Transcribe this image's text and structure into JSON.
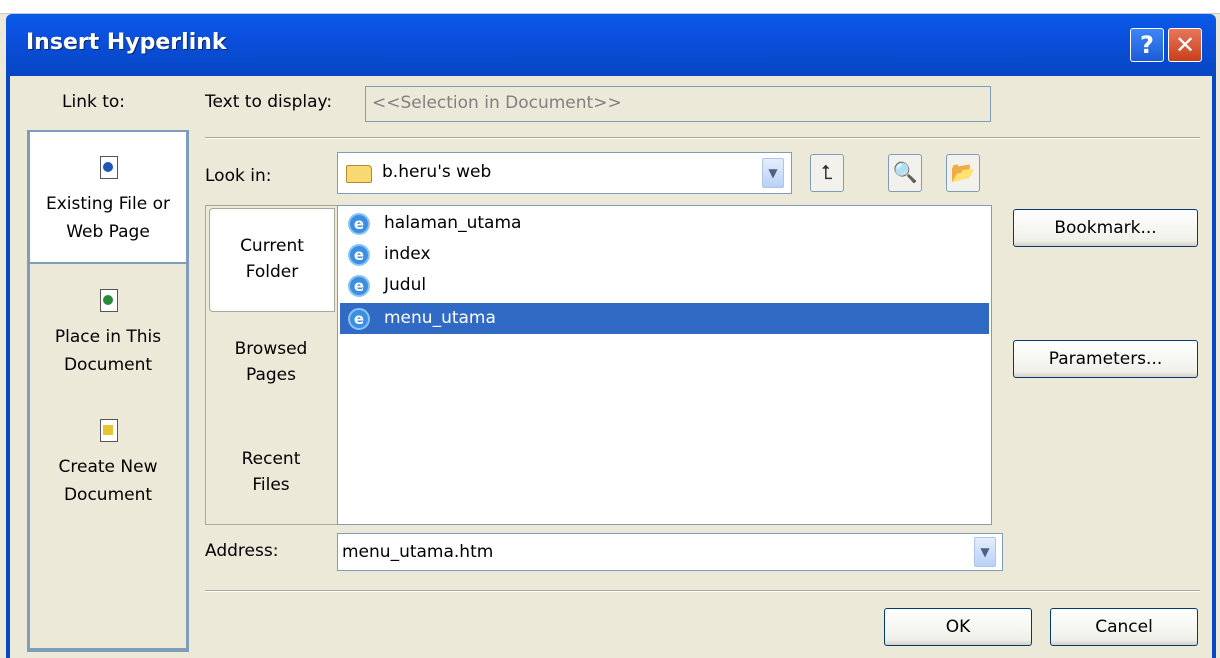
{
  "window": {
    "title": "Insert Hyperlink",
    "help_glyph": "?",
    "close_glyph": "✕",
    "titlebar_color": "#0a4fdc",
    "face_color": "#ece9d8"
  },
  "link_to": {
    "label": "Link to:",
    "places": [
      {
        "line1": "Existing File or",
        "line2": "Web Page",
        "icon": "existing-file-icon",
        "selected": true
      },
      {
        "line1": "Place in This",
        "line2": "Document",
        "icon": "place-in-document-icon",
        "selected": false
      },
      {
        "line1": "Create New",
        "line2": "Document",
        "icon": "new-document-icon",
        "selected": false
      }
    ]
  },
  "text_to_display": {
    "label": "Text to display:",
    "value": "<<Selection in Document>>"
  },
  "look_in": {
    "label": "Look in:",
    "value": "b.heru's web",
    "dropdown_glyph": "▼",
    "toolbar_icons": [
      "up-one-folder-icon",
      "browse-web-icon",
      "browse-file-icon"
    ]
  },
  "tabs": [
    {
      "line1": "Current",
      "line2": "Folder",
      "selected": true
    },
    {
      "line1": "Browsed",
      "line2": "Pages",
      "selected": false
    },
    {
      "line1": "Recent",
      "line2": "Files",
      "selected": false
    }
  ],
  "files": [
    {
      "name": "halaman_utama",
      "selected": false
    },
    {
      "name": "index",
      "selected": false
    },
    {
      "name": "Judul",
      "selected": false
    },
    {
      "name": "menu_utama",
      "selected": true
    }
  ],
  "side_buttons": {
    "bookmark": "Bookmark...",
    "parameters": "Parameters..."
  },
  "address": {
    "label": "Address:",
    "value": "menu_utama.htm",
    "dropdown_glyph": "▼"
  },
  "footer": {
    "ok": "OK",
    "cancel": "Cancel"
  },
  "selection_color": "#316ac5"
}
